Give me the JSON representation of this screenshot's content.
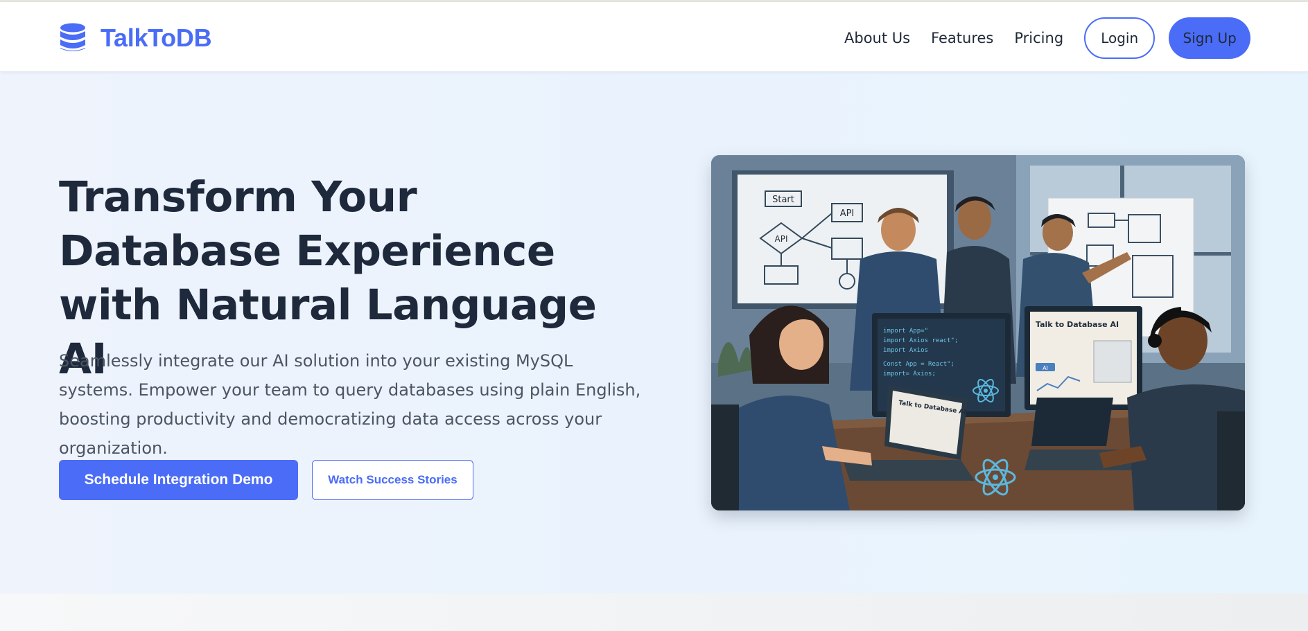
{
  "brand": {
    "name": "TalkToDB",
    "icon": "database-icon",
    "color": "#4a6cf7"
  },
  "nav": {
    "links": [
      "About Us",
      "Features",
      "Pricing"
    ],
    "login_label": "Login",
    "signup_label": "Sign Up"
  },
  "hero": {
    "title": "Transform Your Database Experience with Natural Language AI",
    "subtitle": "Seamlessly integrate our AI solution into your existing MySQL systems. Empower your team to query databases using plain English, boosting productivity and democratizing data access across your organization.",
    "primary_cta": "Schedule Integration Demo",
    "secondary_cta": "Watch Success Stories"
  },
  "illustration": {
    "whiteboard_labels": [
      "Start",
      "API",
      "API"
    ],
    "monitor_code": [
      "import App=\"",
      "import Axios react\";",
      "import Axios",
      "Const App = React\";",
      "import= Axios;"
    ],
    "screen_title": "Talk to Database AI",
    "laptop_title": "Talk to Database AI",
    "ai_badge": "AI"
  },
  "colors": {
    "accent": "#4a6cf7",
    "heading": "#1e293b",
    "body_text": "#4b5563",
    "hero_bg": "#eaf3fd"
  }
}
